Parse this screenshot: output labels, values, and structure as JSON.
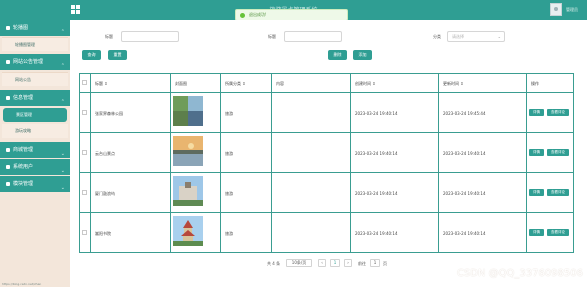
{
  "topbar": {
    "title": "旅游景点管理系统",
    "user": "管理员"
  },
  "toast": {
    "text": "退出成功!"
  },
  "sidebar": {
    "home": "首页",
    "groups": [
      {
        "label": "轮播图",
        "sub": [
          "轮播图管理"
        ]
      },
      {
        "label": "网站公告管理",
        "sub": [
          "网站公告"
        ]
      },
      {
        "label": "信息管理",
        "sub": [
          "景区管理",
          "游玩攻略"
        ]
      },
      {
        "label": "商城管理",
        "sub": []
      },
      {
        "label": "系统用户",
        "sub": []
      },
      {
        "label": "模块管理",
        "sub": []
      }
    ],
    "footer": "https://blog.csdn.net/zhan"
  },
  "search": {
    "label_title": "标题",
    "label_title2": "标题",
    "label_category": "分类",
    "placeholder_category": "请选择"
  },
  "buttons": {
    "query": "查询",
    "reset": "重置",
    "delete": "删除",
    "add": "添加"
  },
  "table": {
    "headers": [
      "",
      "标题 ⇕",
      "封面图",
      "所属分类 ⇕",
      "内容",
      "创建时间 ⇕",
      "更新时间 ⇕",
      "操作"
    ],
    "rows": [
      {
        "title": "张家界森林公园",
        "category": "旅游",
        "content": "",
        "created": "2023-03-24 19:40:14",
        "updated": "2023-03-24 19:45:44"
      },
      {
        "title": "云台山景点",
        "category": "旅游",
        "content": "",
        "created": "2023-03-24 19:40:14",
        "updated": "2023-03-24 19:40:14"
      },
      {
        "title": "厦门鼓浪屿",
        "category": "旅游",
        "content": "",
        "created": "2023-03-24 19:40:14",
        "updated": "2023-03-24 19:40:14"
      },
      {
        "title": "嵩阳书院",
        "category": "旅游",
        "content": "",
        "created": "2023-03-24 19:40:14",
        "updated": "2023-03-24 19:40:14"
      }
    ],
    "action_edit": "详情",
    "action_view": "查看评论"
  },
  "pager": {
    "total": "共 4 条",
    "per_page": "10条/页",
    "current": "1",
    "goto": "前往",
    "goto_val": "1",
    "page_unit": "页"
  },
  "watermark": "CSDN @QQ_3376098506"
}
